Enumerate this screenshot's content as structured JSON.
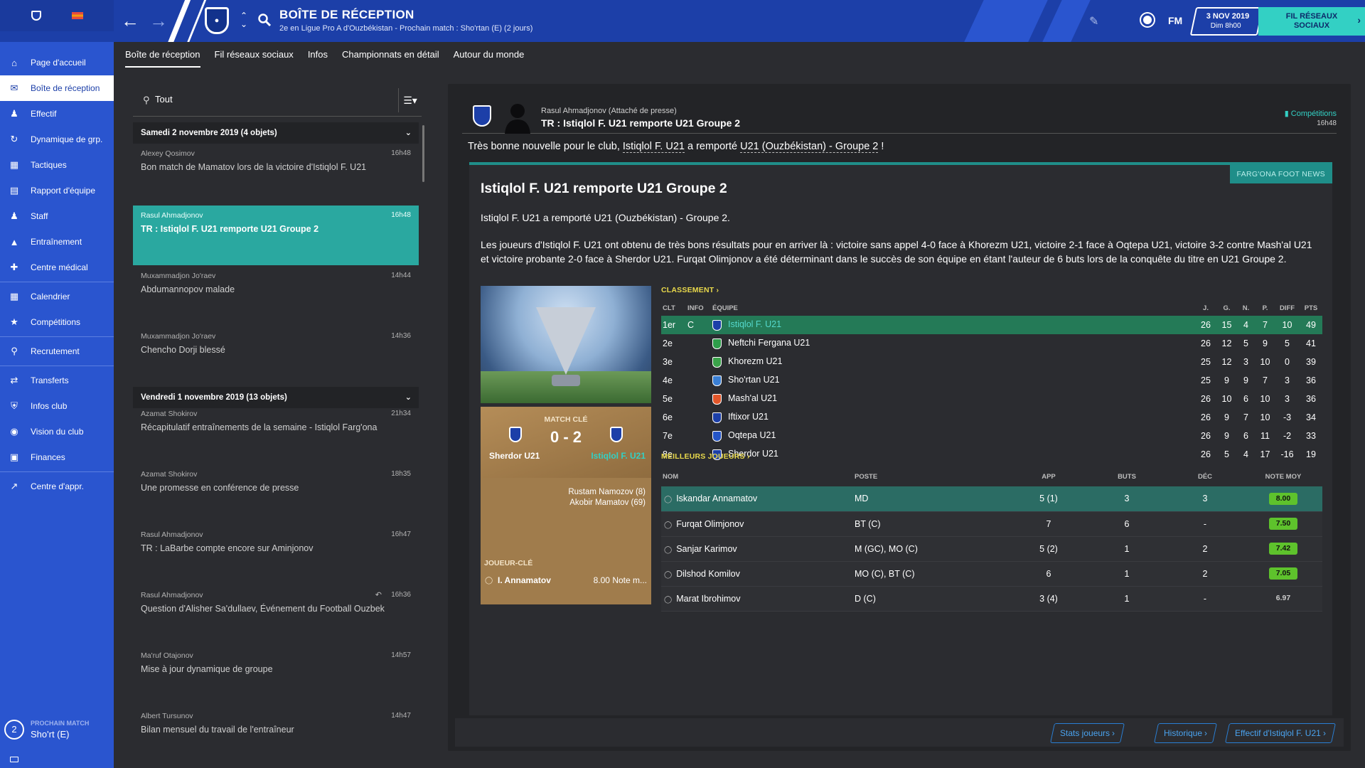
{
  "header": {
    "title": "BOÎTE DE RÉCEPTION",
    "subtitle": "2e en Ligue Pro A d'Ouzbékistan - Prochain match : Sho'rtan (E) (2 jours)",
    "fm_label": "FM",
    "date": "3 NOV 2019",
    "time": "Dim 8h00",
    "social_line1": "FIL RÉSEAUX",
    "social_line2": "SOCIAUX"
  },
  "sidebar": {
    "items": [
      {
        "label": "Page d'accueil",
        "icon": "home-icon"
      },
      {
        "label": "Boîte de réception",
        "icon": "inbox-icon"
      },
      {
        "label": "Effectif",
        "icon": "squad-icon"
      },
      {
        "label": "Dynamique de grp.",
        "icon": "dynamics-icon"
      },
      {
        "label": "Tactiques",
        "icon": "tactics-icon"
      },
      {
        "label": "Rapport d'équipe",
        "icon": "report-icon"
      },
      {
        "label": "Staff",
        "icon": "staff-icon"
      },
      {
        "label": "Entraînement",
        "icon": "training-icon"
      },
      {
        "label": "Centre médical",
        "icon": "medical-icon"
      },
      {
        "label": "Calendrier",
        "icon": "calendar-icon"
      },
      {
        "label": "Compétitions",
        "icon": "trophy-icon"
      },
      {
        "label": "Recrutement",
        "icon": "scouting-icon"
      },
      {
        "label": "Transferts",
        "icon": "transfers-icon"
      },
      {
        "label": "Infos club",
        "icon": "club-info-icon"
      },
      {
        "label": "Vision du club",
        "icon": "vision-icon"
      },
      {
        "label": "Finances",
        "icon": "finances-icon"
      },
      {
        "label": "Centre d'appr.",
        "icon": "dev-centre-icon"
      }
    ],
    "next_match_label": "PROCHAIN MATCH",
    "next_match_team": "Sho'rt (E)",
    "next_match_days": "2"
  },
  "tabs": [
    "Boîte de réception",
    "Fil réseaux sociaux",
    "Infos",
    "Championnats en détail",
    "Autour du monde"
  ],
  "inbox": {
    "filter": "Tout",
    "groups": [
      {
        "title": "Samedi 2 novembre 2019 (4 objets)"
      },
      {
        "title": "Vendredi 1 novembre 2019 (13 objets)"
      }
    ],
    "messages": [
      {
        "from": "Alexey Qosimov",
        "time": "16h48",
        "subject": "Bon match de Mamatov lors de la victoire d'Istiqlol F. U21"
      },
      {
        "from": "Rasul Ahmadjonov",
        "time": "16h48",
        "subject": "TR : Istiqlol F. U21 remporte U21 Groupe 2"
      },
      {
        "from": "Muxammadjon Jo'raev",
        "time": "14h44",
        "subject": "Abdumannopov malade"
      },
      {
        "from": "Muxammadjon Jo'raev",
        "time": "14h36",
        "subject": "Chencho Dorji blessé"
      },
      {
        "from": "Azamat Shokirov",
        "time": "21h34",
        "subject": "Récapitulatif entraînements de la semaine - Istiqlol Farg'ona"
      },
      {
        "from": "Azamat Shokirov",
        "time": "18h35",
        "subject": "Une promesse en conférence de presse"
      },
      {
        "from": "Rasul Ahmadjonov",
        "time": "16h47",
        "subject": "TR : LaBarbe compte encore sur Aminjonov"
      },
      {
        "from": "Rasul Ahmadjonov",
        "time": "16h36",
        "subject": "Question d'Alisher Sa'dullaev, Événement du Football Ouzbek"
      },
      {
        "from": "Ma'ruf Otajonov",
        "time": "14h57",
        "subject": "Mise à jour dynamique de groupe"
      },
      {
        "from": "Albert Tursunov",
        "time": "14h47",
        "subject": "Bilan mensuel du travail de l'entraîneur"
      }
    ]
  },
  "detail": {
    "sender": "Rasul Ahmadjonov  (Attaché de presse)",
    "subject": "TR : Istiqlol F. U21 remporte U21 Groupe 2",
    "category": "Compétitions",
    "time": "16h48",
    "intro_a": "Très bonne nouvelle pour le club, ",
    "intro_club": "Istiqlol F. U21",
    "intro_b": " a remporté ",
    "intro_comp": "U21 (Ouzbékistan) - Groupe 2",
    "intro_c": " !",
    "source": "FARG'ONA FOOT NEWS",
    "article_title": "Istiqlol F. U21 remporte U21 Groupe 2",
    "article_lead": "Istiqlol F. U21 a remporté U21 (Ouzbékistan) - Groupe 2.",
    "article_body": "Les joueurs d'Istiqlol F. U21 ont obtenu de très bons résultats pour en arriver là : victoire sans appel 4-0 face à Khorezm U21, victoire 2-1 face à Oqtepa U21, victoire 3-2 contre Mash'al U21 et victoire probante 2-0 face à Sherdor U21. Furqat Olimjonov a été déterminant dans le succès de son équipe en étant l'auteur de 6 buts lors de la conquête du titre en U21 Groupe 2.",
    "key_match": {
      "label": "MATCH CLÉ",
      "score": "0 - 2",
      "home": "Sherdor U21",
      "away": "Istiqlol F. U21",
      "scorer1": "Rustam Namozov (8)",
      "scorer2": "Akobir Mamatov (69)",
      "key_player_label": "JOUEUR-CLÉ",
      "key_player": "I. Annamatov",
      "key_player_note": "8.00 Note m..."
    },
    "standings_title": "CLASSEMENT",
    "standings_headers": [
      "CLT",
      "INFO",
      "ÉQUIPE",
      "J.",
      "G.",
      "N.",
      "P.",
      "DIFF",
      "PTS"
    ],
    "standings": [
      {
        "pos": "1er",
        "info": "C",
        "team": "Istiqlol F. U21",
        "color": "#1c3fa8",
        "p": "26",
        "w": "15",
        "d": "4",
        "l": "7",
        "diff": "10",
        "pts": "49"
      },
      {
        "pos": "2e",
        "info": "",
        "team": "Neftchi Fergana U21",
        "color": "#2e9d4a",
        "p": "26",
        "w": "12",
        "d": "5",
        "l": "9",
        "diff": "5",
        "pts": "41"
      },
      {
        "pos": "3e",
        "info": "",
        "team": "Khorezm U21",
        "color": "#3aa24a",
        "p": "25",
        "w": "12",
        "d": "3",
        "l": "10",
        "diff": "0",
        "pts": "39"
      },
      {
        "pos": "4e",
        "info": "",
        "team": "Sho'rtan U21",
        "color": "#3a7fd4",
        "p": "25",
        "w": "9",
        "d": "9",
        "l": "7",
        "diff": "3",
        "pts": "36"
      },
      {
        "pos": "5e",
        "info": "",
        "team": "Mash'al U21",
        "color": "#e2562a",
        "p": "26",
        "w": "10",
        "d": "6",
        "l": "10",
        "diff": "3",
        "pts": "36"
      },
      {
        "pos": "6e",
        "info": "",
        "team": "Iftixor U21",
        "color": "#1c3fa8",
        "p": "26",
        "w": "9",
        "d": "7",
        "l": "10",
        "diff": "-3",
        "pts": "34"
      },
      {
        "pos": "7e",
        "info": "",
        "team": "Oqtepa U21",
        "color": "#2455c8",
        "p": "26",
        "w": "9",
        "d": "6",
        "l": "11",
        "diff": "-2",
        "pts": "33"
      },
      {
        "pos": "8e",
        "info": "",
        "team": "Sherdor U21",
        "color": "#1c3fa8",
        "p": "26",
        "w": "5",
        "d": "4",
        "l": "17",
        "diff": "-16",
        "pts": "19"
      }
    ],
    "players_title": "MEILLEURS JOUEURS",
    "players_headers": [
      "NOM",
      "POSTE",
      "APP",
      "BUTS",
      "DÉC",
      "NOTE MOY"
    ],
    "players": [
      {
        "name": "Iskandar Annamatov",
        "pos": "MD",
        "app": "5 (1)",
        "goals": "3",
        "assists": "3",
        "rating": "8.00"
      },
      {
        "name": "Furqat Olimjonov",
        "pos": "BT (C)",
        "app": "7",
        "goals": "6",
        "assists": "-",
        "rating": "7.50"
      },
      {
        "name": "Sanjar Karimov",
        "pos": "M (GC), MO (C)",
        "app": "5 (2)",
        "goals": "1",
        "assists": "2",
        "rating": "7.42"
      },
      {
        "name": "Dilshod Komilov",
        "pos": "MO (C), BT (C)",
        "app": "6",
        "goals": "1",
        "assists": "2",
        "rating": "7.05"
      },
      {
        "name": "Marat Ibrohimov",
        "pos": "D (C)",
        "app": "3 (4)",
        "goals": "1",
        "assists": "-",
        "rating": "6.97"
      }
    ],
    "footer_buttons": [
      "Stats joueurs",
      "Historique",
      "Effectif d'Istiqlol F. U21"
    ]
  }
}
